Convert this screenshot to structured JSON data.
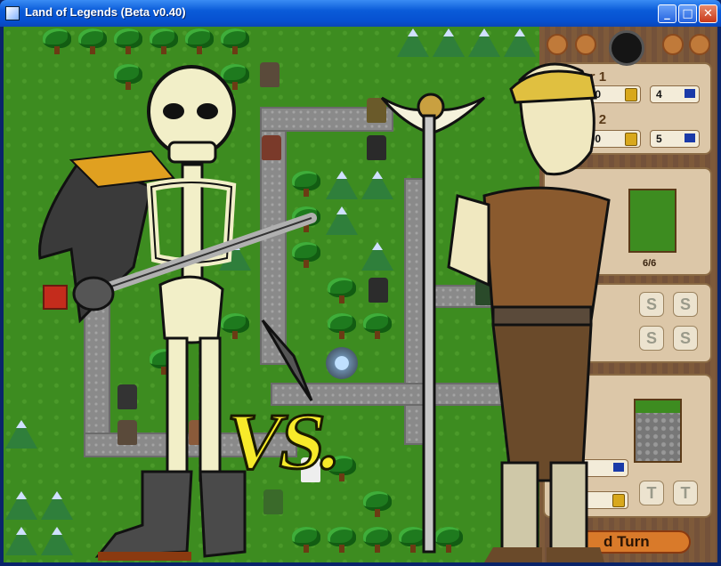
{
  "window": {
    "title": "Land of Legends (Beta v0.40)",
    "min": "_",
    "max": "□",
    "close": "✕"
  },
  "panel": {
    "player1": {
      "label": "yer 1",
      "money": "$28800",
      "flags": "4"
    },
    "player2": {
      "label": "yer 2",
      "money": "$17900",
      "flags": "5"
    },
    "unit_hp": "6/6",
    "slots": [
      "S",
      "S",
      "S",
      "S"
    ],
    "tslots": [
      "T",
      "T"
    ],
    "end_turn": "d Turn"
  },
  "splash": {
    "vs_text": "VS."
  },
  "colors": {
    "grass": "#3d8c20",
    "panel": "#7a5638",
    "vs": "#f7ea2a"
  },
  "icons": [
    "skeleton",
    "mage",
    "tree",
    "mountain",
    "fountain",
    "coin",
    "flag"
  ]
}
